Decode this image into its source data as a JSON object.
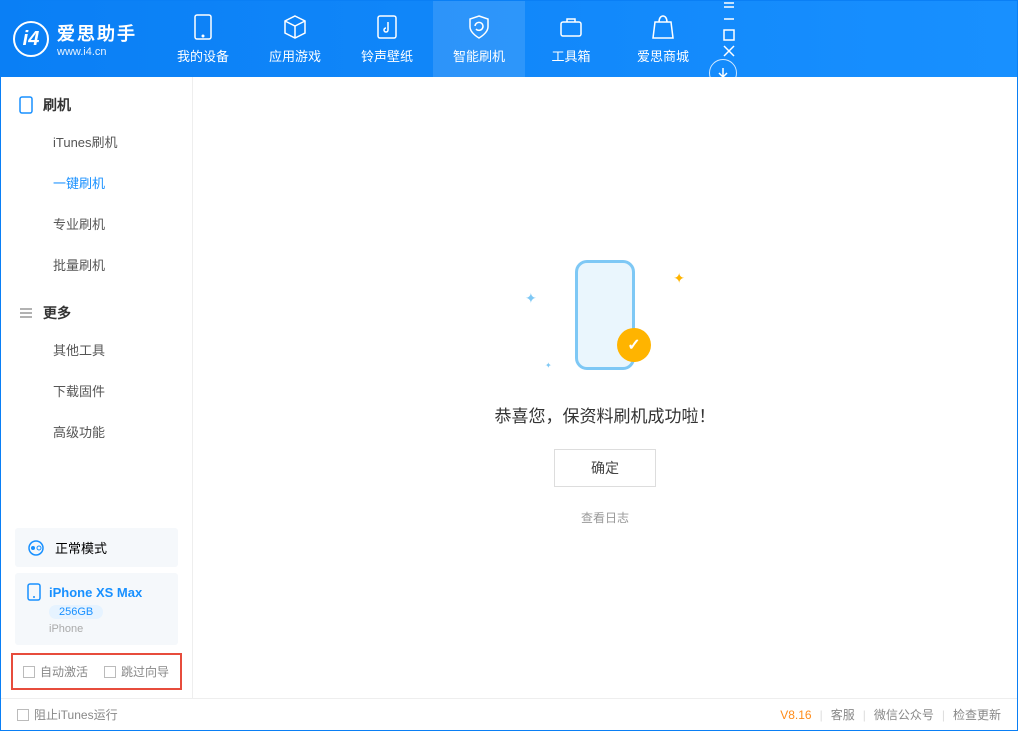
{
  "app": {
    "name": "爱思助手",
    "url": "www.i4.cn"
  },
  "nav": {
    "my_device": "我的设备",
    "apps_games": "应用游戏",
    "ringtones": "铃声壁纸",
    "flash": "智能刷机",
    "toolbox": "工具箱",
    "store": "爱思商城"
  },
  "sidebar": {
    "section_flash": "刷机",
    "itunes_flash": "iTunes刷机",
    "one_click": "一键刷机",
    "pro_flash": "专业刷机",
    "batch_flash": "批量刷机",
    "section_more": "更多",
    "other_tools": "其他工具",
    "download_fw": "下载固件",
    "advanced": "高级功能"
  },
  "mode": {
    "label": "正常模式"
  },
  "device": {
    "name": "iPhone XS Max",
    "storage": "256GB",
    "type": "iPhone"
  },
  "checks": {
    "auto_activate": "自动激活",
    "skip_guide": "跳过向导"
  },
  "main": {
    "success": "恭喜您，保资料刷机成功啦！",
    "ok": "确定",
    "view_log": "查看日志"
  },
  "status": {
    "block_itunes": "阻止iTunes运行",
    "version": "V8.16",
    "support": "客服",
    "wechat": "微信公众号",
    "update": "检查更新"
  }
}
